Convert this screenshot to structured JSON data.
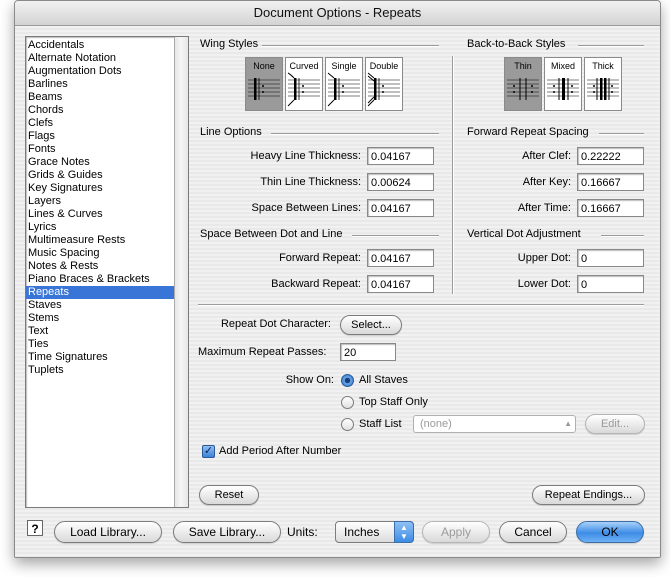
{
  "window": {
    "title": "Document Options - Repeats"
  },
  "sidebar": {
    "items": [
      "Accidentals",
      "Alternate Notation",
      "Augmentation Dots",
      "Barlines",
      "Beams",
      "Chords",
      "Clefs",
      "Flags",
      "Fonts",
      "Grace Notes",
      "Grids & Guides",
      "Key Signatures",
      "Layers",
      "Lines & Curves",
      "Lyrics",
      "Multimeasure Rests",
      "Music Spacing",
      "Notes & Rests",
      "Piano Braces & Brackets",
      "Repeats",
      "Staves",
      "Stems",
      "Text",
      "Ties",
      "Time Signatures",
      "Tuplets"
    ],
    "selected": "Repeats"
  },
  "wing_styles": {
    "title": "Wing Styles",
    "options": [
      "None",
      "Curved",
      "Single",
      "Double"
    ],
    "selected": "None"
  },
  "b2b_styles": {
    "title": "Back-to-Back Styles",
    "options": [
      "Thin",
      "Mixed",
      "Thick"
    ],
    "selected": "Thin"
  },
  "line_options": {
    "title": "Line Options",
    "heavy_label": "Heavy Line Thickness:",
    "heavy_value": "0.04167",
    "thin_label": "Thin Line Thickness:",
    "thin_value": "0.00624",
    "space_label": "Space Between Lines:",
    "space_value": "0.04167"
  },
  "forward_spacing": {
    "title": "Forward Repeat Spacing",
    "clef_label": "After Clef:",
    "clef_value": "0.22222",
    "key_label": "After Key:",
    "key_value": "0.16667",
    "time_label": "After Time:",
    "time_value": "0.16667"
  },
  "dot_line": {
    "title": "Space Between Dot and Line",
    "forward_label": "Forward Repeat:",
    "forward_value": "0.04167",
    "backward_label": "Backward Repeat:",
    "backward_value": "0.04167"
  },
  "vertical_dot": {
    "title": "Vertical Dot Adjustment",
    "upper_label": "Upper Dot:",
    "upper_value": "0",
    "lower_label": "Lower Dot:",
    "lower_value": "0"
  },
  "repeat_dot": {
    "label": "Repeat Dot Character:",
    "button": "Select..."
  },
  "max_passes": {
    "label": "Maximum Repeat Passes:",
    "value": "20"
  },
  "show_on": {
    "label": "Show On:",
    "options": [
      "All Staves",
      "Top Staff Only",
      "Staff List"
    ],
    "selected": "All Staves",
    "staff_list_value": "(none)",
    "edit_button": "Edit..."
  },
  "period": {
    "label": "Add Period After Number",
    "checked": true
  },
  "reset_button": "Reset",
  "repeat_endings_button": "Repeat Endings...",
  "footer": {
    "help": "?",
    "load": "Load Library...",
    "save": "Save Library...",
    "units_label": "Units:",
    "units_value": "Inches",
    "apply": "Apply",
    "cancel": "Cancel",
    "ok": "OK"
  },
  "colors": {
    "selection": "#3875d7",
    "default_button": "#3d8ce6",
    "window_bg": "#ececec"
  }
}
